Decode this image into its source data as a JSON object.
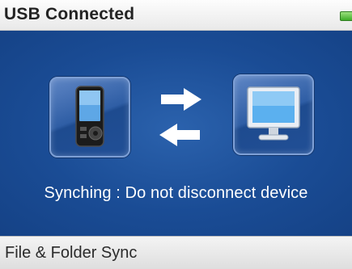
{
  "header": {
    "title": "USB Connected",
    "battery_icon": "battery-icon",
    "battery_level": 1.0,
    "battery_color": "#3fae2a"
  },
  "main": {
    "background_color": "#1a4c95",
    "left_icon": "media-player-icon",
    "right_icon": "computer-monitor-icon",
    "sync_icons": [
      "arrow-right-icon",
      "arrow-left-icon"
    ],
    "status_text": "Synching : Do not disconnect device"
  },
  "footer": {
    "label": "File & Folder Sync"
  }
}
